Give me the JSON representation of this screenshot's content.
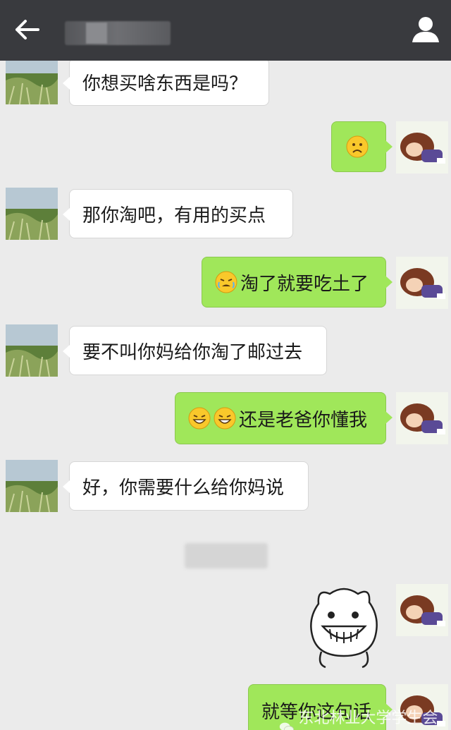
{
  "header": {
    "contact_name": "",
    "back_icon": "arrow-left-icon",
    "profile_icon": "person-icon"
  },
  "messages": [
    {
      "side": "in",
      "text": "你想买啥东西是吗？"
    },
    {
      "side": "out",
      "emoji": "frown-emoji",
      "text": ""
    },
    {
      "side": "in",
      "text": "那你淘吧，有用的买点"
    },
    {
      "side": "out",
      "emoji": "crying-emoji",
      "text": "淘了就要吃土了"
    },
    {
      "side": "in",
      "text": "要不叫你妈给你淘了邮过去"
    },
    {
      "side": "out",
      "emoji": "grin-emoji",
      "text": "还是老爸你懂我"
    },
    {
      "side": "in",
      "text": "好，你需要什么给你妈说"
    },
    {
      "side": "out",
      "sticker": "grinning-cartoon-sticker"
    },
    {
      "side": "out",
      "text": "就等你这句话"
    }
  ],
  "watermark": "东北林业大学学生会学习部",
  "colors": {
    "topbar": "#393a3e",
    "outgoing_bubble": "#a0e75a",
    "incoming_bubble": "#ffffff",
    "background": "#ebebeb"
  }
}
